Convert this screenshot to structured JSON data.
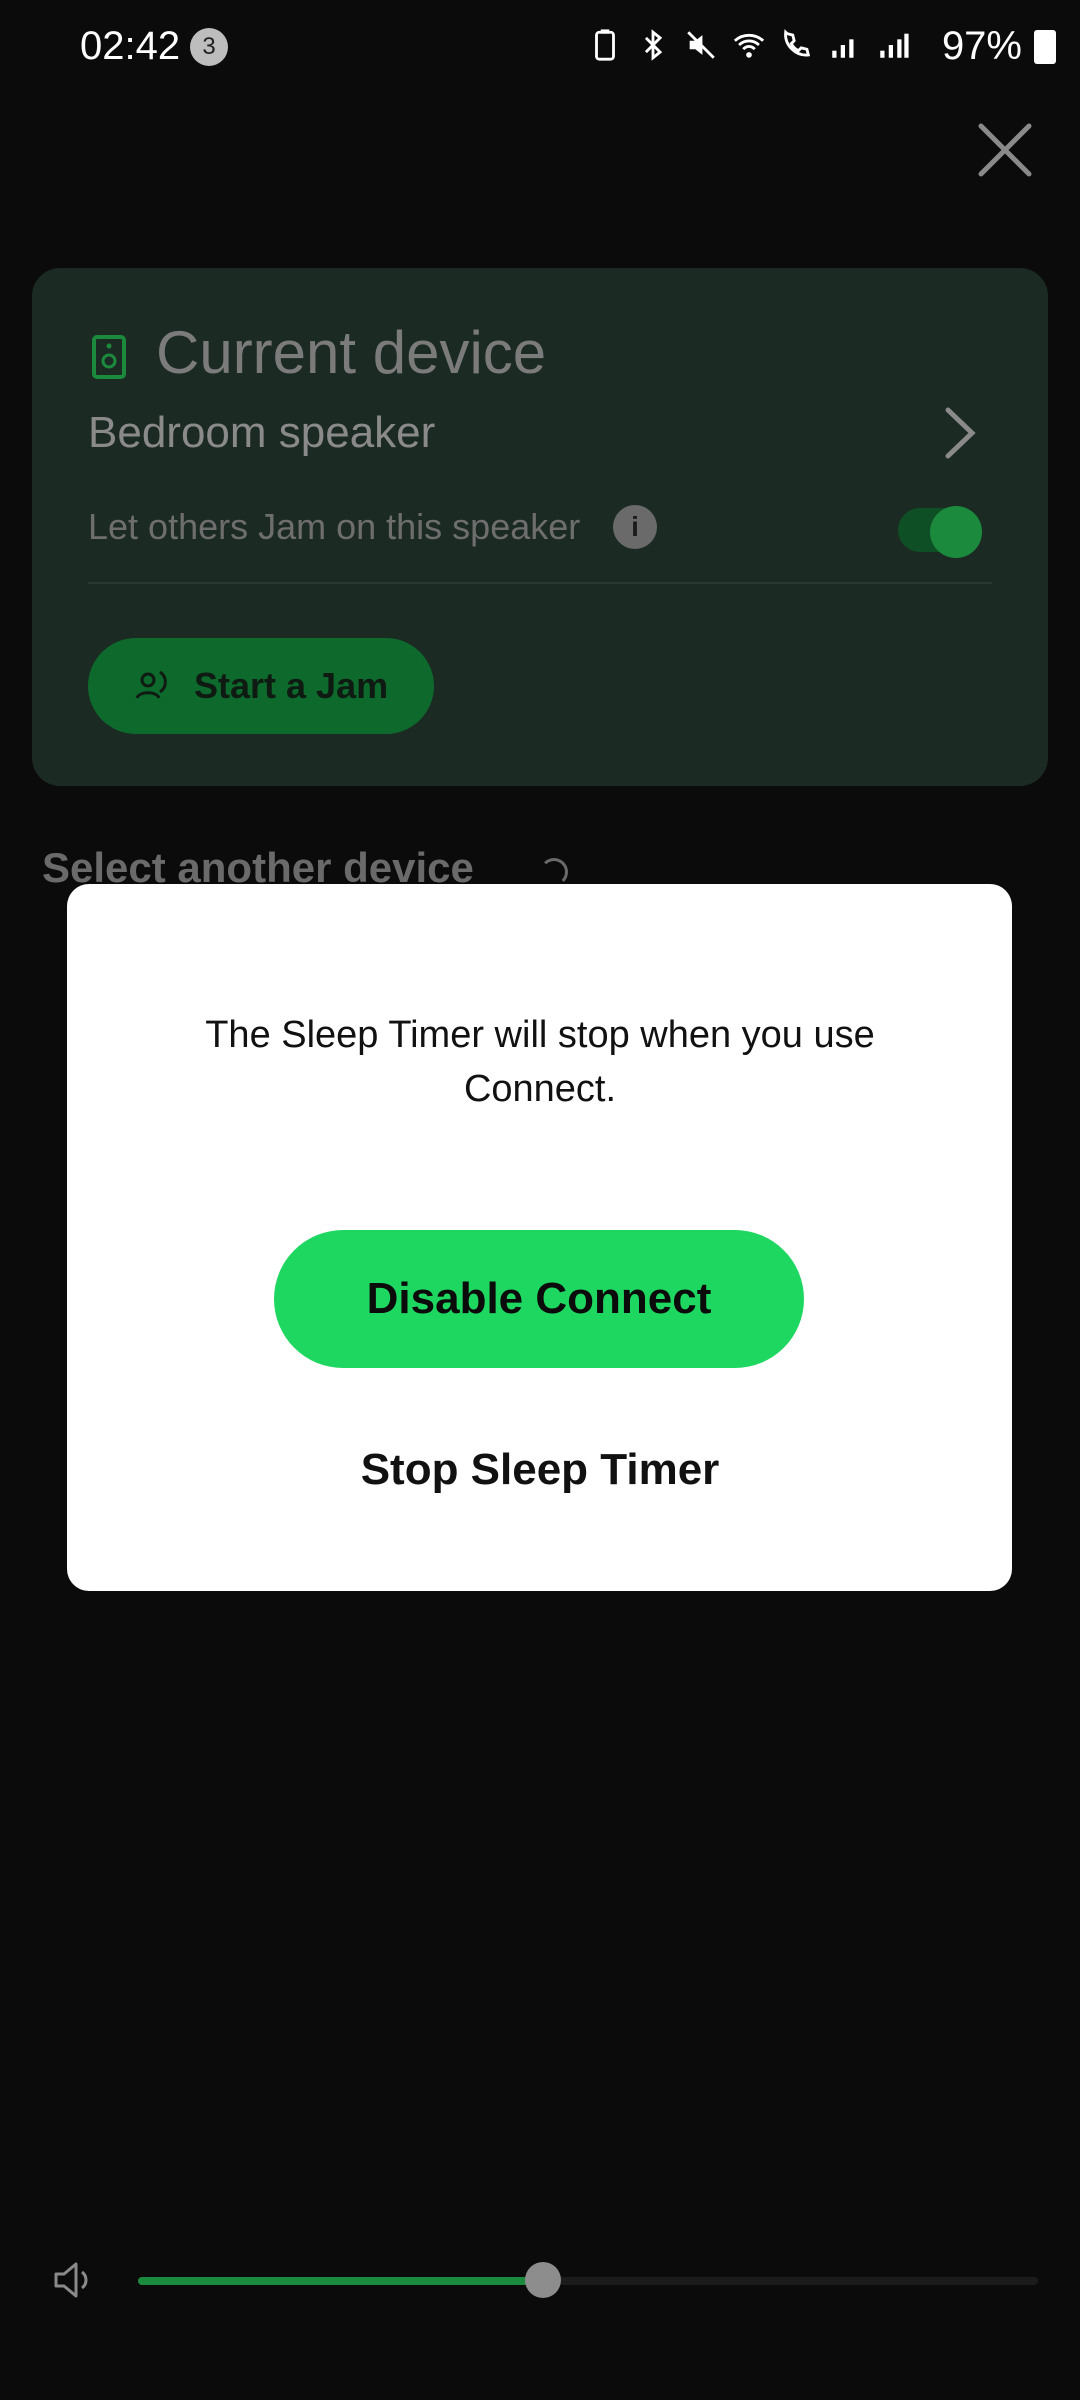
{
  "status_bar": {
    "time": "02:42",
    "notification_count": "3",
    "battery_percent": "97%"
  },
  "card": {
    "title": "Current device",
    "device_name": "Bedroom speaker",
    "jam_toggle_label": "Let others Jam on this speaker",
    "jam_toggle_on": true,
    "start_jam_label": "Start a Jam",
    "info_glyph": "i"
  },
  "select_section": {
    "title": "Select another device"
  },
  "dialog": {
    "message": "The Sleep Timer will stop when you use Connect.",
    "primary_label": "Disable Connect",
    "secondary_label": "Stop Sleep Timer"
  },
  "volume": {
    "level_percent": 45
  },
  "colors": {
    "accent": "#1ed760",
    "background": "#0b0b0b",
    "dialog_bg": "#ffffff"
  },
  "icons": [
    "close-icon",
    "speaker-icon",
    "chevron-right-icon",
    "info-icon",
    "jam-icon",
    "volume-icon",
    "bluetooth-icon",
    "mute-icon",
    "wifi-icon",
    "wifi-call-icon",
    "signal-icon",
    "battery-icon",
    "battery-saver-icon"
  ]
}
